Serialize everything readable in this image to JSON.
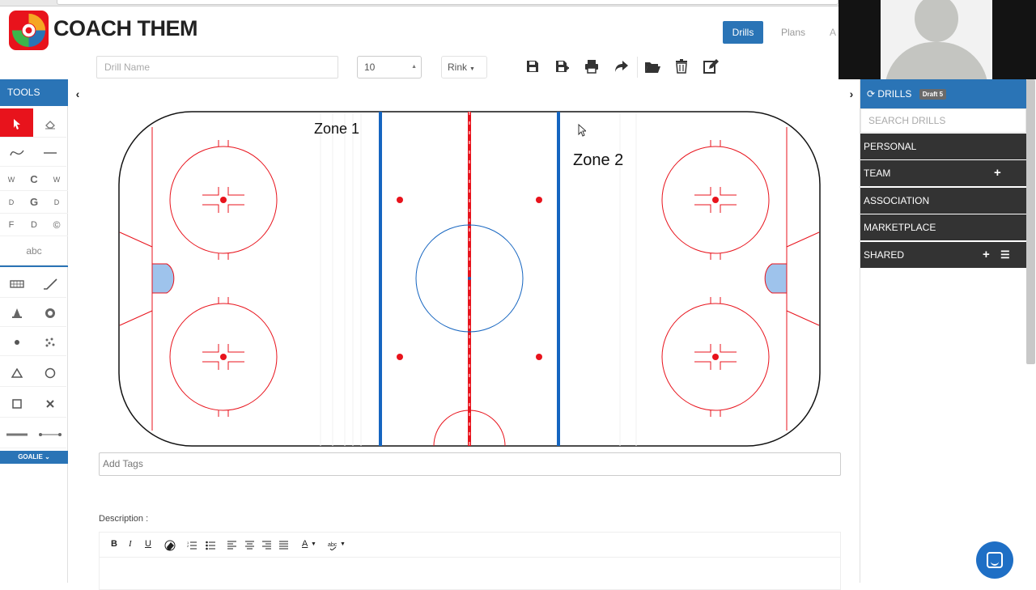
{
  "header": {
    "brand": "COACH THEM",
    "nav": [
      {
        "label": "Drills"
      },
      {
        "label": "Plans"
      },
      {
        "label": "A"
      }
    ]
  },
  "toolbar": {
    "drill_name_placeholder": "Drill Name",
    "number_value": "10",
    "surface_value": "Rink"
  },
  "tools": {
    "title": "TOOLS",
    "letters": [
      "W",
      "C",
      "W",
      "D",
      "G",
      "D",
      "F",
      "D",
      "©"
    ],
    "text_tool": "abc",
    "goalie_label": "GOALIE"
  },
  "rink": {
    "zone1": "Zone 1",
    "zone2": "Zone 2",
    "colors": {
      "red": "#e8131c",
      "blue": "#1565c0",
      "crease": "#9ec3ec"
    }
  },
  "tags": {
    "placeholder": "Add Tags"
  },
  "description": {
    "label": "Description :",
    "editor": {
      "bold": "B",
      "italic": "I",
      "underline": "U",
      "font_color": "A"
    }
  },
  "drills_panel": {
    "title": "DRILLS",
    "draft_badge": "Draft 5",
    "search_placeholder": "SEARCH DRILLS",
    "categories": [
      {
        "label": "PERSONAL"
      },
      {
        "label": "TEAM"
      },
      {
        "label": "ASSOCIATION"
      },
      {
        "label": "MARKETPLACE"
      },
      {
        "label": "SHARED"
      }
    ]
  }
}
